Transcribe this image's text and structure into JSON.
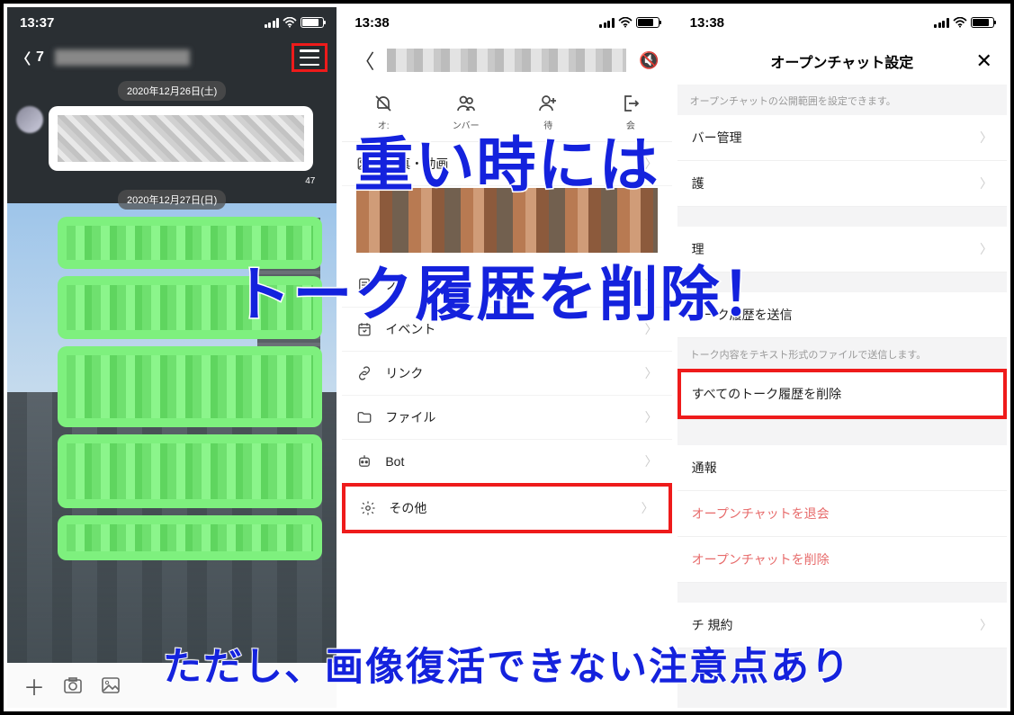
{
  "overlay": {
    "line1": "重い時には",
    "line2": "トーク履歴を削除！",
    "line3": "ただし、画像復活できない注意点あり"
  },
  "screen1": {
    "time": "13:37",
    "back_count": "7",
    "date1": "2020年12月26日(土)",
    "date2": "2020年12月27日(日)",
    "read_small": "47"
  },
  "screen2": {
    "time": "13:38",
    "tool_off": "オ:",
    "tool_members": "ンバー",
    "tool_invite": "待",
    "tool_leave": "会",
    "photo_video": "写真・動画",
    "note": "ノ",
    "event": "イベント",
    "link": "リンク",
    "file": "ファイル",
    "bot": "Bot",
    "other": "その他"
  },
  "screen3": {
    "time": "13:38",
    "title": "オープンチャット設定",
    "help1": "オープンチャットの公開範囲を設定できます。",
    "member_mgmt": "バー管理",
    "priv": "護",
    "mgmt2": "理",
    "send_history": "トーク履歴を送信",
    "help2": "トーク内容をテキスト形式のファイルで送信します。",
    "delete_all": "すべてのトーク履歴を削除",
    "report": "通報",
    "leave": "オープンチャットを退会",
    "delete_chat": "オープンチャットを削除",
    "rules": "チ        規約"
  }
}
